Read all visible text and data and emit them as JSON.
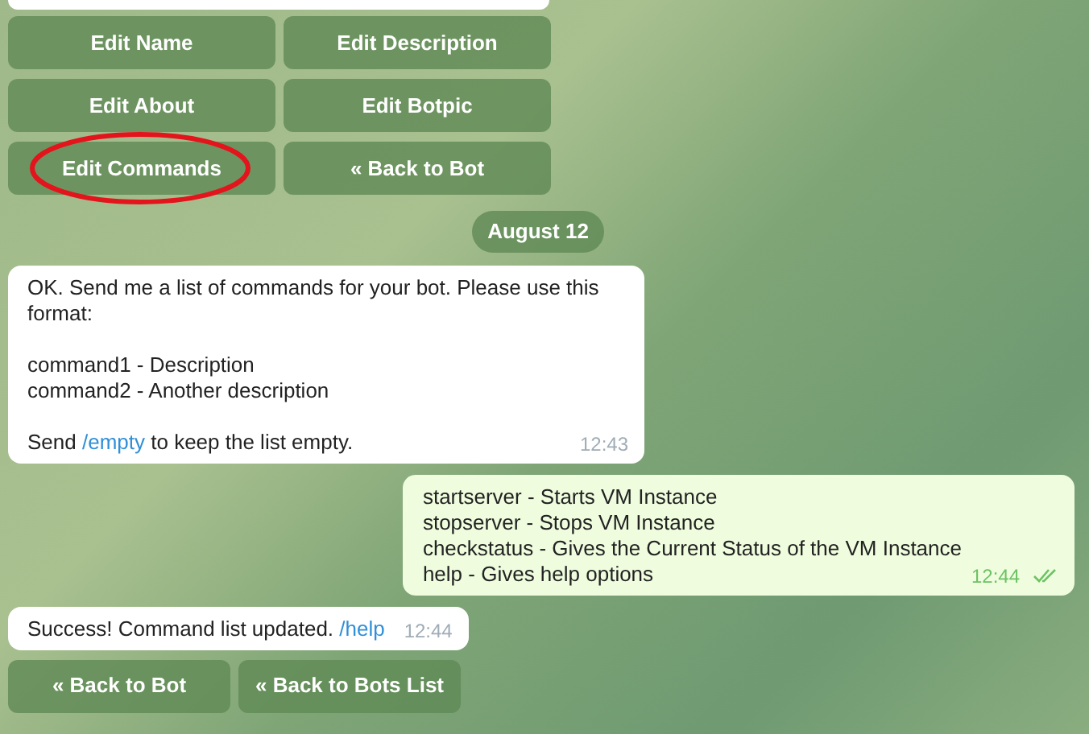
{
  "top_keyboard": [
    [
      {
        "label": "Edit Name",
        "highlighted": false
      },
      {
        "label": "Edit Description",
        "highlighted": false
      }
    ],
    [
      {
        "label": "Edit About",
        "highlighted": false
      },
      {
        "label": "Edit Botpic",
        "highlighted": false
      }
    ],
    [
      {
        "label": "Edit Commands",
        "highlighted": true
      },
      {
        "label": "« Back to Bot",
        "highlighted": false
      }
    ]
  ],
  "date_badge": "August 12",
  "messages": [
    {
      "kind": "incoming",
      "time": "12:43",
      "read": false,
      "lines": [
        {
          "space_before": false,
          "parts": [
            {
              "kind": "text",
              "text": "OK. Send me a list of commands for your bot. Please use this format:"
            }
          ]
        },
        {
          "space_before": true,
          "parts": [
            {
              "kind": "text",
              "text": "command1 - Description"
            }
          ]
        },
        {
          "space_before": false,
          "parts": [
            {
              "kind": "text",
              "text": "command2 - Another description"
            }
          ]
        },
        {
          "space_before": true,
          "parts": [
            {
              "kind": "text",
              "text": "Send "
            },
            {
              "kind": "link",
              "text": "/empty"
            },
            {
              "kind": "text",
              "text": " to keep the list empty."
            }
          ]
        }
      ]
    },
    {
      "kind": "outgoing",
      "time": "12:44",
      "read": true,
      "lines": [
        {
          "space_before": false,
          "parts": [
            {
              "kind": "text",
              "text": "startserver - Starts VM Instance"
            }
          ]
        },
        {
          "space_before": false,
          "parts": [
            {
              "kind": "text",
              "text": "stopserver - Stops VM Instance"
            }
          ]
        },
        {
          "space_before": false,
          "parts": [
            {
              "kind": "text",
              "text": "checkstatus - Gives the Current Status of the VM Instance"
            }
          ]
        },
        {
          "space_before": false,
          "parts": [
            {
              "kind": "text",
              "text": "help - Gives help options"
            }
          ]
        }
      ]
    },
    {
      "kind": "incoming",
      "time": "12:44",
      "read": false,
      "lines": [
        {
          "space_before": false,
          "parts": [
            {
              "kind": "text",
              "text": "Success! Command list updated. "
            },
            {
              "kind": "link",
              "text": "/help"
            }
          ]
        }
      ]
    }
  ],
  "bottom_keyboard": [
    [
      {
        "label": "« Back to Bot",
        "highlighted": false
      },
      {
        "label": "« Back to Bots List",
        "highlighted": false
      }
    ]
  ]
}
